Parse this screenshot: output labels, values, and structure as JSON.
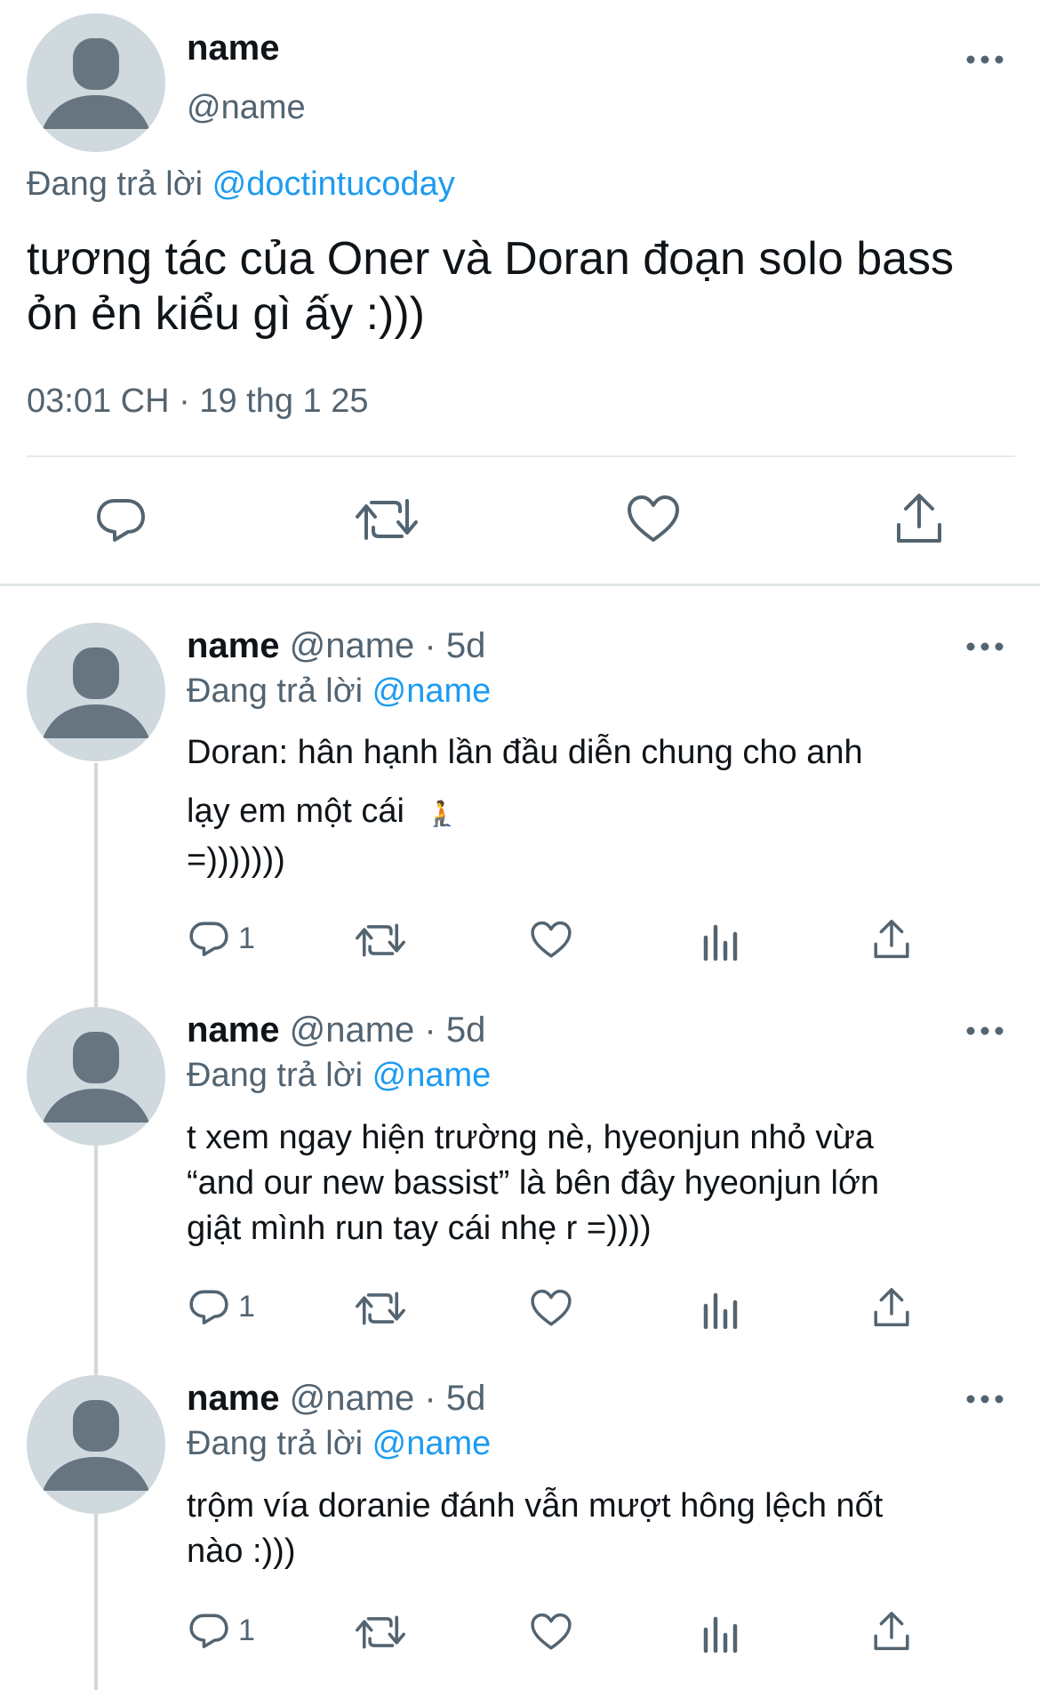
{
  "main_tweet": {
    "name": "name",
    "handle": "@name",
    "replying_prefix": "Đang trả lời",
    "replying_to": "@doctintucoday",
    "text_line1": "tương tác của Oner và Doran đoạn solo bass",
    "text_line2": "ỏn ẻn kiểu gì ấy :)))",
    "timestamp": "03:01 CH · 19 thg 1 25"
  },
  "replies": [
    {
      "name": "name",
      "handle": "@name",
      "time": "· 5d",
      "replying_prefix": "Đang trả lời",
      "replying_to": "@name",
      "line1": "Doran: hân hạnh lần đầu diễn chung cho anh",
      "line2": "lạy em một cái",
      "line2_emoji": "🧎",
      "line3": "=)))))))",
      "reply_count": "1"
    },
    {
      "name": "name",
      "handle": "@name",
      "time": "· 5d",
      "replying_prefix": "Đang trả lời",
      "replying_to": "@name",
      "line1": "t xem ngay hiện trường nè, hyeonjun nhỏ vừa",
      "line2": "“and our new bassist” là bên đây hyeonjun lớn",
      "line3": "giật mình run tay cái nhẹ r =))))",
      "reply_count": "1"
    },
    {
      "name": "name",
      "handle": "@name",
      "time": "· 5d",
      "replying_prefix": "Đang trả lời",
      "replying_to": "@name",
      "line1": "trộm vía doranie đánh vẫn mượt hông lệch nốt",
      "line2": "nào :)))",
      "reply_count": "1"
    }
  ],
  "colors": {
    "accent": "#1d9bf0",
    "secondary_text": "#536471",
    "avatar_bg": "#cfd9de",
    "avatar_fg": "#66757f"
  },
  "icons": [
    "reply-icon",
    "retweet-icon",
    "like-icon",
    "share-icon",
    "views-icon",
    "more-icon"
  ]
}
